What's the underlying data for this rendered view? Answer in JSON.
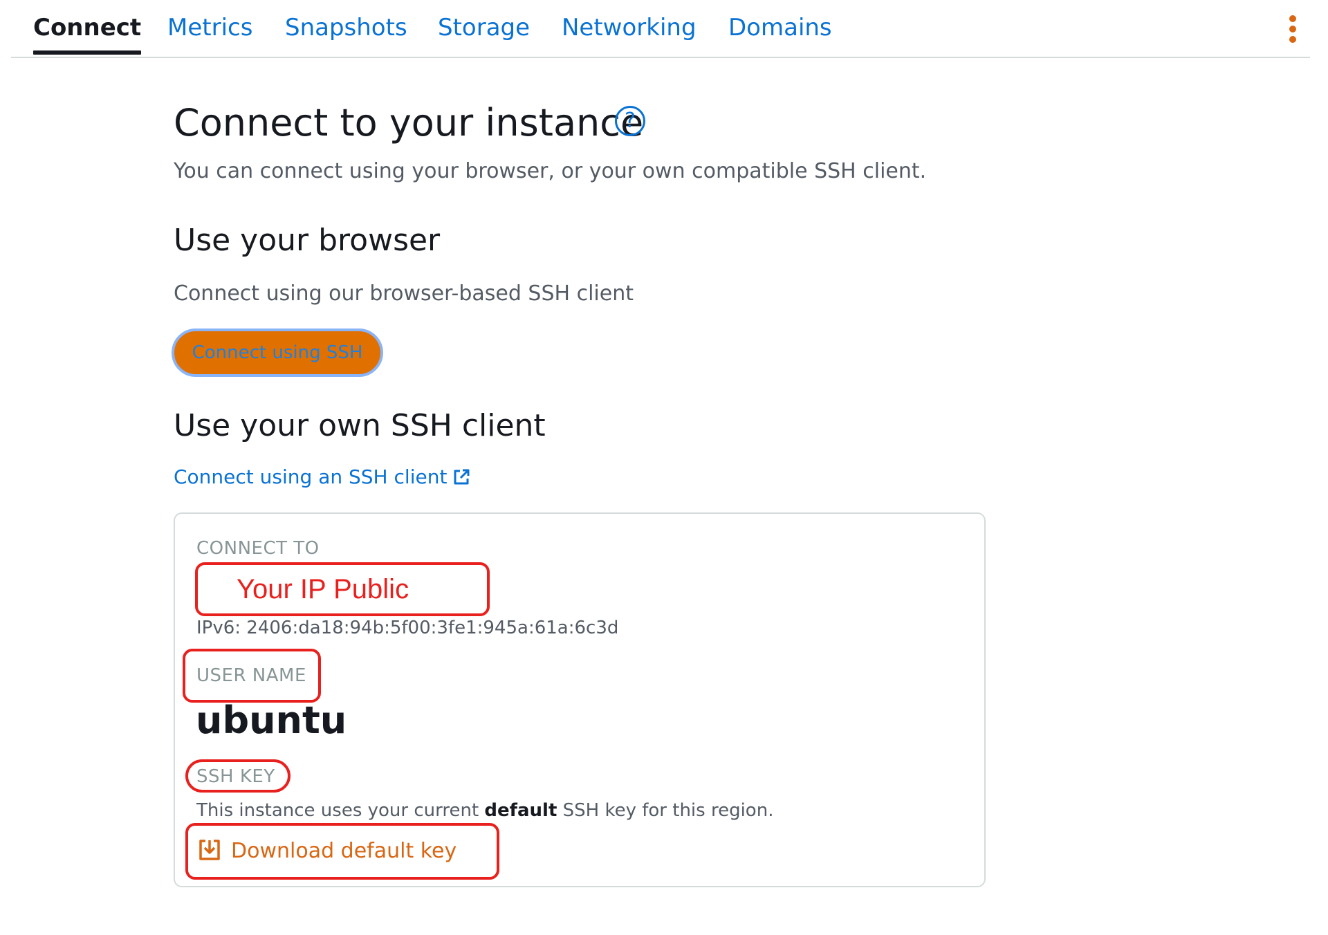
{
  "tabs": [
    {
      "label": "Connect",
      "active": true
    },
    {
      "label": "Metrics",
      "active": false
    },
    {
      "label": "Snapshots",
      "active": false
    },
    {
      "label": "Storage",
      "active": false
    },
    {
      "label": "Networking",
      "active": false
    },
    {
      "label": "Domains",
      "active": false
    }
  ],
  "header": {
    "title": "Connect to your instance",
    "help_icon": "question-circle-icon",
    "subtitle": "You can connect using your browser, or your own compatible SSH client."
  },
  "browser_section": {
    "heading": "Use your browser",
    "description": "Connect using our browser-based SSH client",
    "button_label": "Connect using SSH"
  },
  "client_section": {
    "heading": "Use your own SSH client",
    "link_label": "Connect using an SSH client",
    "link_icon": "external-link-icon"
  },
  "card": {
    "connect_to_label": "CONNECT TO",
    "ip_value": "Your IP Public",
    "ipv6": "IPv6: 2406:da18:94b:5f00:3fe1:945a:61a:6c3d",
    "user_name_label": "USER NAME",
    "user_name": "ubuntu",
    "ssh_key_label": "SSH KEY",
    "key_text_before": "This instance uses your current ",
    "key_text_bold": "default",
    "key_text_after": " SSH key for this region.",
    "download_label": "Download default key",
    "download_icon": "download-icon"
  },
  "colors": {
    "link": "#0972d3",
    "accent_orange": "#d86613",
    "annotation_red": "#e8211e"
  }
}
